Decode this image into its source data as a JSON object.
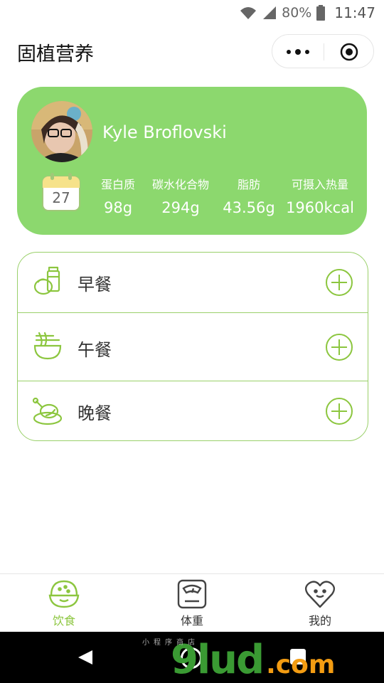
{
  "status_bar": {
    "battery": "80%",
    "time": "11:47"
  },
  "title_bar": {
    "app_title": "固植营养"
  },
  "profile": {
    "name": "Kyle Broflovski",
    "calendar_day": "27",
    "stats": [
      {
        "label": "蛋白质",
        "value": "98g"
      },
      {
        "label": "碳水化合物",
        "value": "294g"
      },
      {
        "label": "脂肪",
        "value": "43.56g"
      },
      {
        "label": "可摄入热量",
        "value": "1960kcal"
      }
    ]
  },
  "meals": [
    {
      "label": "早餐"
    },
    {
      "label": "午餐"
    },
    {
      "label": "晚餐"
    }
  ],
  "tabs": [
    {
      "label": "饮食",
      "active": true
    },
    {
      "label": "体重",
      "active": false
    },
    {
      "label": "我的",
      "active": false
    }
  ],
  "watermark": {
    "main": "9lud",
    "tail": ".com",
    "sub": "小程序商店"
  },
  "colors": {
    "accent": "#8cd86e",
    "border": "#9ad06a",
    "active_tab": "#8cc63f"
  }
}
